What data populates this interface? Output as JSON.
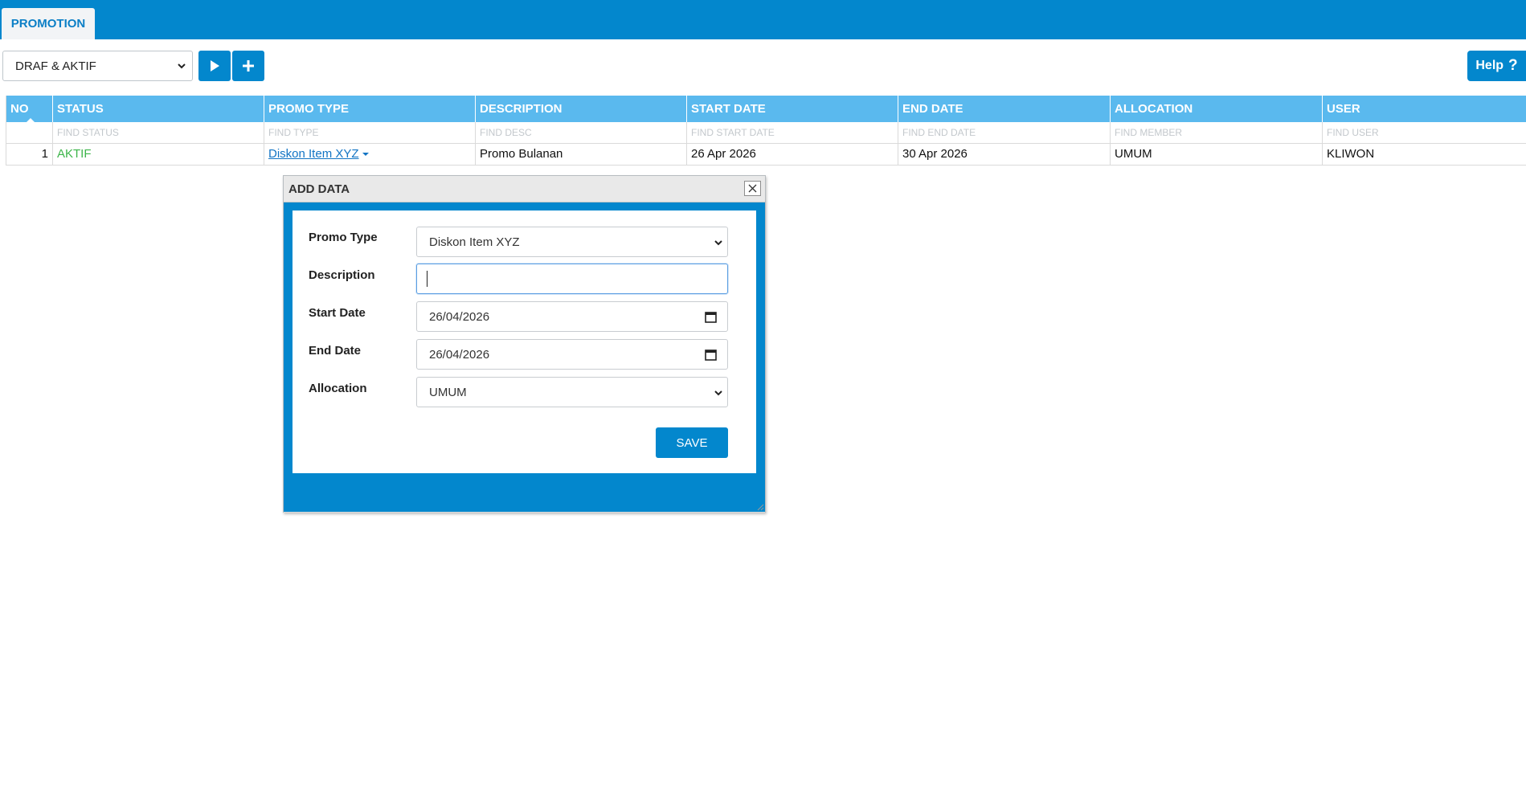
{
  "tabs": [
    {
      "label": "PROMOTION",
      "active": true
    }
  ],
  "toolbar": {
    "filter_value": "DRAF & AKTIF",
    "help_label": "Help",
    "help_icon": "question-icon"
  },
  "grid": {
    "columns": [
      "NO",
      "STATUS",
      "PROMO TYPE",
      "DESCRIPTION",
      "START DATE",
      "END DATE",
      "ALLOCATION",
      "USER"
    ],
    "filters": [
      "",
      "FIND STATUS",
      "FIND TYPE",
      "FIND DESC",
      "FIND START DATE",
      "FIND END DATE",
      "FIND MEMBER",
      "FIND USER"
    ],
    "rows": [
      {
        "no": "1",
        "status": "AKTIF",
        "promo_type": "Diskon Item XYZ",
        "description": "Promo Bulanan",
        "start_date": "26 Apr 2026",
        "end_date": "30 Apr 2026",
        "allocation": "UMUM",
        "user": "KLIWON"
      }
    ]
  },
  "dialog": {
    "title": "ADD DATA",
    "fields": {
      "promo_type": {
        "label": "Promo Type",
        "value": "Diskon Item XYZ"
      },
      "description": {
        "label": "Description",
        "value": ""
      },
      "start_date": {
        "label": "Start Date",
        "value": "26/04/2026"
      },
      "end_date": {
        "label": "End Date",
        "value": "26/04/2026"
      },
      "allocation": {
        "label": "Allocation",
        "value": "UMUM"
      }
    },
    "save_label": "SAVE"
  },
  "colors": {
    "primary": "#0387cd",
    "header": "#5ab9ee",
    "status_active": "#3db54a",
    "link": "#1274c4"
  }
}
